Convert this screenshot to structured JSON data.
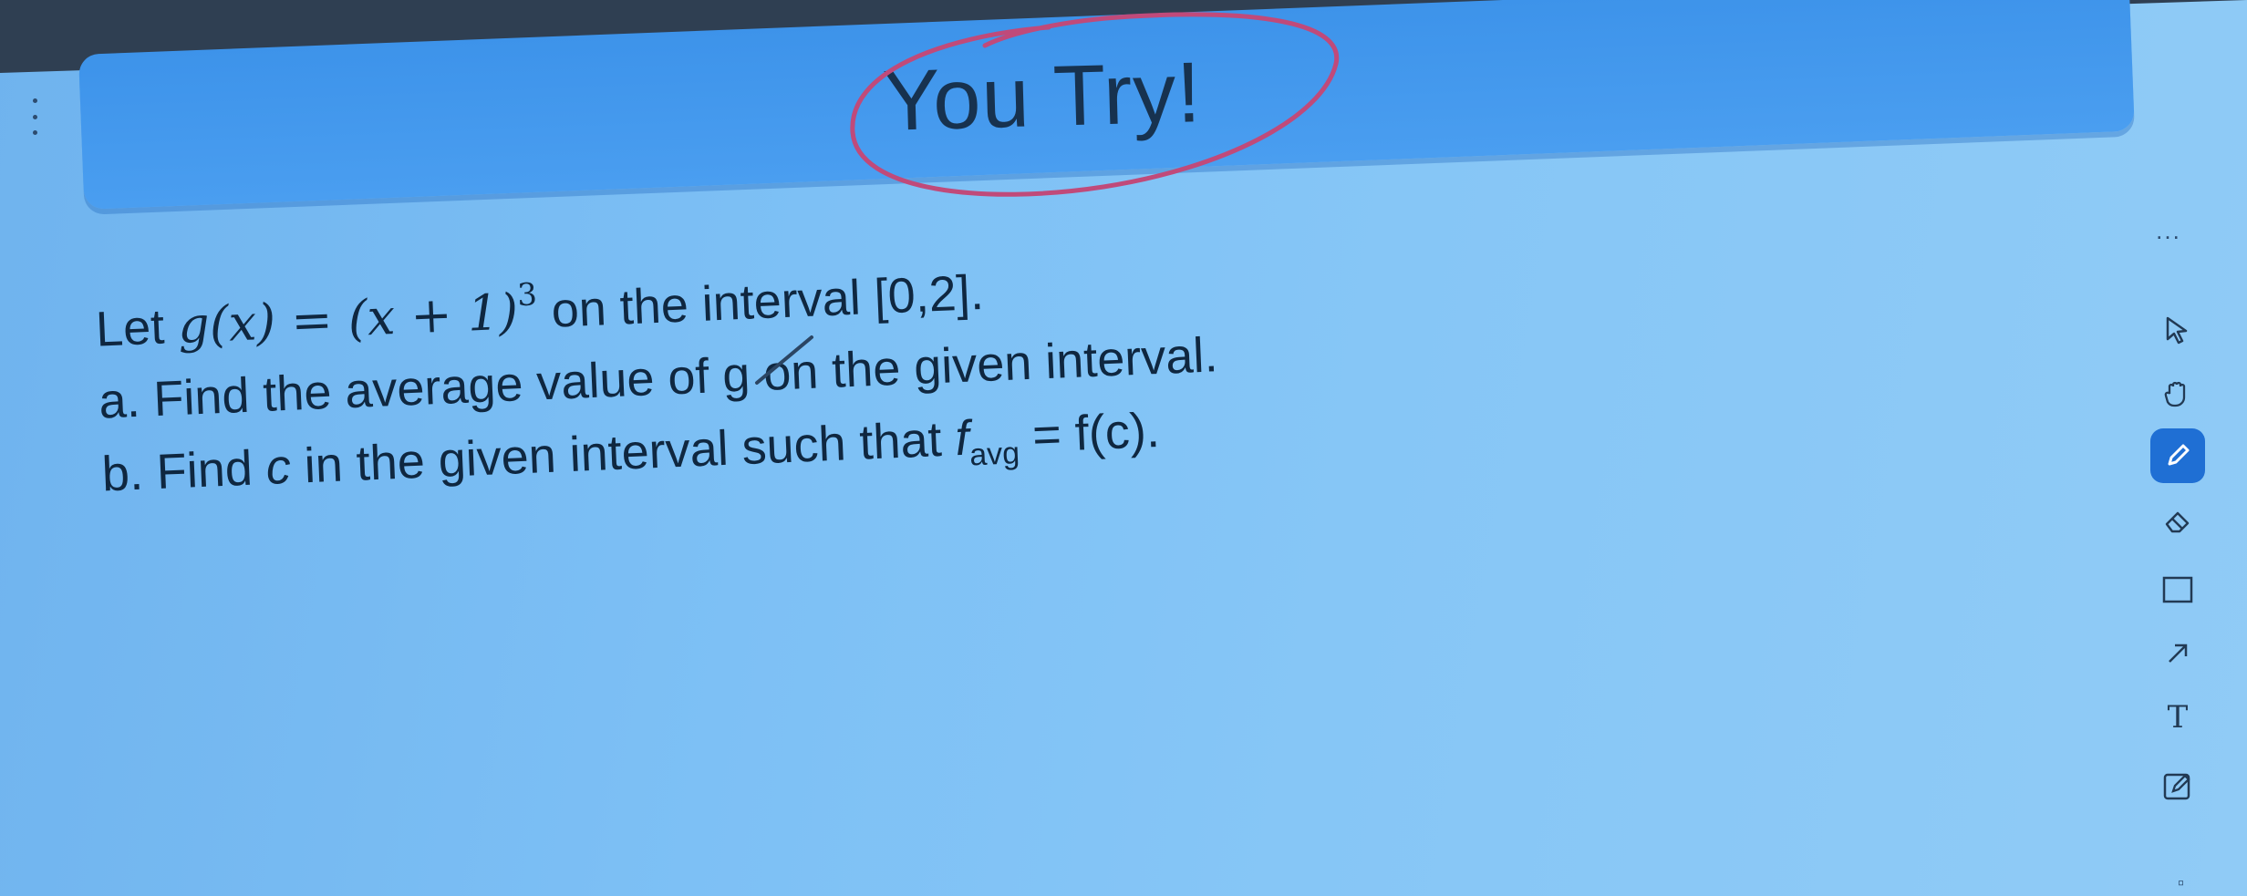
{
  "banner": {
    "title": "You Try!"
  },
  "problem": {
    "intro_prefix": "Let ",
    "function": "g(x) = (x + 1)",
    "exponent": "3",
    "intro_suffix": " on the interval [0,2].",
    "part_a": "a. Find the average value of g on the given interval.",
    "part_b_prefix": "b. Find ",
    "part_b_var": "c",
    "part_b_mid": " in the given interval such that ",
    "part_b_f": "f",
    "part_b_sub": "avg",
    "part_b_suffix": " = f(c)."
  },
  "toolbar": {
    "more": "...",
    "tools": [
      "pointer-icon",
      "hand-icon",
      "pen-icon",
      "eraser-icon",
      "rectangle-icon",
      "arrow-icon",
      "text-icon",
      "note-edit-icon"
    ],
    "text_tool_glyph": "T",
    "active_tool": "pen-icon"
  },
  "colors": {
    "accent": "#1f6fd4",
    "banner": "#3d93ea",
    "circle": "#c04a7a"
  }
}
